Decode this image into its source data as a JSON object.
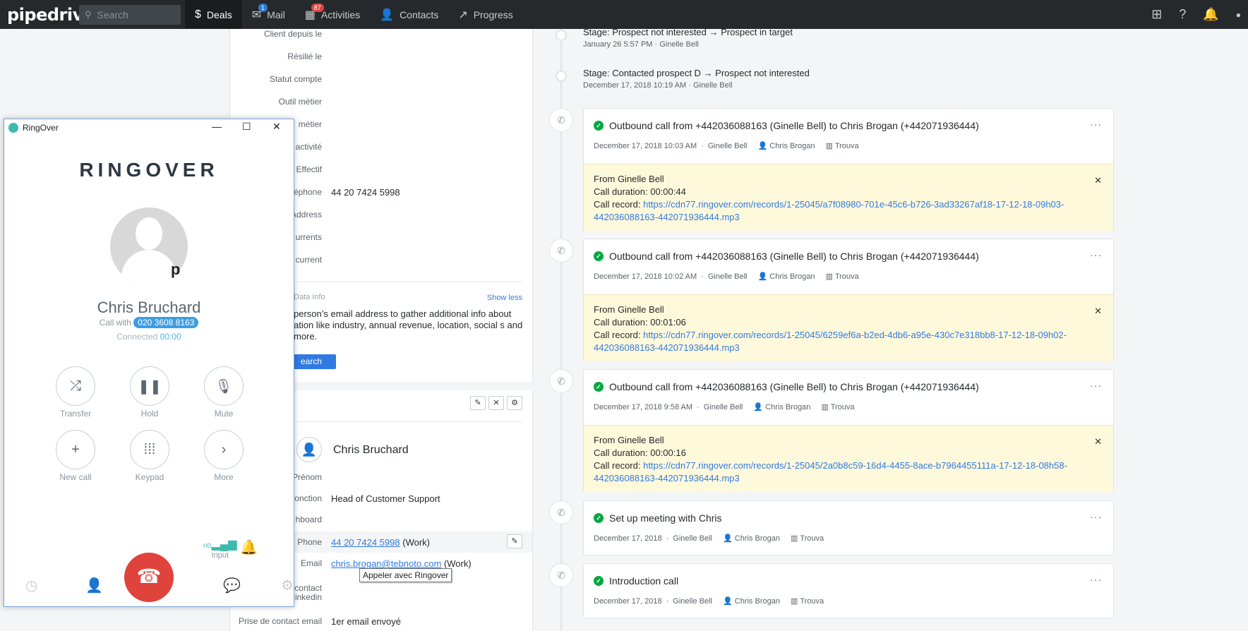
{
  "nav": {
    "logo": "pipedrive",
    "search_placeholder": "Search",
    "items": [
      {
        "label": "Deals",
        "badge": ""
      },
      {
        "label": "Mail",
        "badge": "1"
      },
      {
        "label": "Activities",
        "badge": "87"
      },
      {
        "label": "Contacts",
        "badge": ""
      },
      {
        "label": "Progress",
        "badge": ""
      }
    ]
  },
  "details": {
    "fields": [
      {
        "label": "Client depuis le",
        "value": ""
      },
      {
        "label": "Résilié le",
        "value": ""
      },
      {
        "label": "Statut compte",
        "value": ""
      },
      {
        "label": "Outil métier",
        "value": ""
      },
      {
        "label": "métier",
        "value": ""
      },
      {
        "label": "activité",
        "value": ""
      },
      {
        "label": "Effectif",
        "value": ""
      },
      {
        "label": "éphone",
        "value": "44 20 7424 5998"
      },
      {
        "label": "Address",
        "value": ""
      },
      {
        "label": "urrents",
        "value": ""
      },
      {
        "label": "current",
        "value": ""
      }
    ],
    "data_info_label": "Data Info",
    "show_less": "Show less",
    "data_text": "person’s email address to gather additional info about ation like industry, annual revenue, location, social s and more.",
    "search_btn": "earch"
  },
  "person": {
    "name": "Chris Bruchard",
    "fields": [
      {
        "label": "Prénom",
        "value": ""
      },
      {
        "label": "onction",
        "value": "Head of Customer Support"
      },
      {
        "label": "hboard",
        "value": ""
      },
      {
        "label": "Phone",
        "value": "44 20 7424 5998",
        "suffix": "(Work)"
      },
      {
        "label": "Email",
        "value": "chris.brogan@tebnoto.com",
        "suffix": "(Work)"
      },
      {
        "label": "contact inkedin",
        "value": ""
      },
      {
        "label": "Prise de contact email",
        "value": "1er email envoyé"
      }
    ],
    "tooltip": "Appeler avec Ringover"
  },
  "timeline": {
    "stage_changes": [
      {
        "text": "Stage: Prospect not interested → Prospect in target",
        "date": "January 26 5:57 PM",
        "user": "Ginelle Bell"
      },
      {
        "text": "Stage: Contacted prospect D → Prospect not interested",
        "date": "December 17, 2018 10:19 AM",
        "user": "Ginelle Bell"
      }
    ],
    "activities": [
      {
        "title": "Outbound call from +442036088163 (Ginelle Bell) to Chris Brogan (+442071936444)",
        "date": "December 17, 2018 10:03 AM",
        "user": "Ginelle Bell",
        "person": "Chris Brogan",
        "org": "Trouva",
        "note_from": "From Ginelle Bell",
        "note_duration": "Call duration: 00:00:44",
        "note_record_label": "Call record:",
        "note_url": "https://cdn77.ringover.com/records/1-25045/a7f08980-701e-45c6-b726-3ad33267af18-17-12-18-09h03-442036088163-442071936444.mp3"
      },
      {
        "title": "Outbound call from +442036088163 (Ginelle Bell) to Chris Brogan (+442071936444)",
        "date": "December 17, 2018 10:02 AM",
        "user": "Ginelle Bell",
        "person": "Chris Brogan",
        "org": "Trouva",
        "note_from": "From Ginelle Bell",
        "note_duration": "Call duration: 00:01:06",
        "note_record_label": "Call record:",
        "note_url": "https://cdn77.ringover.com/records/1-25045/6259ef6a-b2ed-4db6-a95e-430c7e318bb8-17-12-18-09h02-442036088163-442071936444.mp3"
      },
      {
        "title": "Outbound call from +442036088163 (Ginelle Bell) to Chris Brogan (+442071936444)",
        "date": "December 17, 2018 9:58 AM",
        "user": "Ginelle Bell",
        "person": "Chris Brogan",
        "org": "Trouva",
        "note_from": "From Ginelle Bell",
        "note_duration": "Call duration: 00:00:16",
        "note_record_label": "Call record:",
        "note_url": "https://cdn77.ringover.com/records/1-25045/2a0b8c59-16d4-4455-8ace-b7964455111a-17-12-18-08h58-442036088163-442071936444.mp3"
      },
      {
        "title": "Set up meeting with Chris",
        "date": "December 17, 2018",
        "user": "Ginelle Bell",
        "person": "Chris Brogan",
        "org": "Trouva"
      },
      {
        "title": "Introduction call",
        "date": "December 17, 2018",
        "user": "Ginelle Bell",
        "person": "Chris Brogan",
        "org": "Trouva"
      }
    ]
  },
  "ringover": {
    "window_title": "RingOver",
    "brand": "RINGOVER",
    "avatar_letter": "p",
    "contact_name": "Chris Bruchard",
    "call_with_label": "Call with",
    "call_number": "020 3608 8163",
    "connected_label": "Connected",
    "connected_time": "00:00",
    "controls": [
      "Transfer",
      "Hold",
      "Mute",
      "New call",
      "Keypad",
      "More"
    ],
    "input_label": "Input",
    "hd_label": "HD"
  },
  "colors": {
    "nav_bg": "#26292c",
    "accent": "#317ae2",
    "check_green": "#08a742",
    "note_bg": "#fff9dc",
    "hangup_red": "#e0433b"
  }
}
